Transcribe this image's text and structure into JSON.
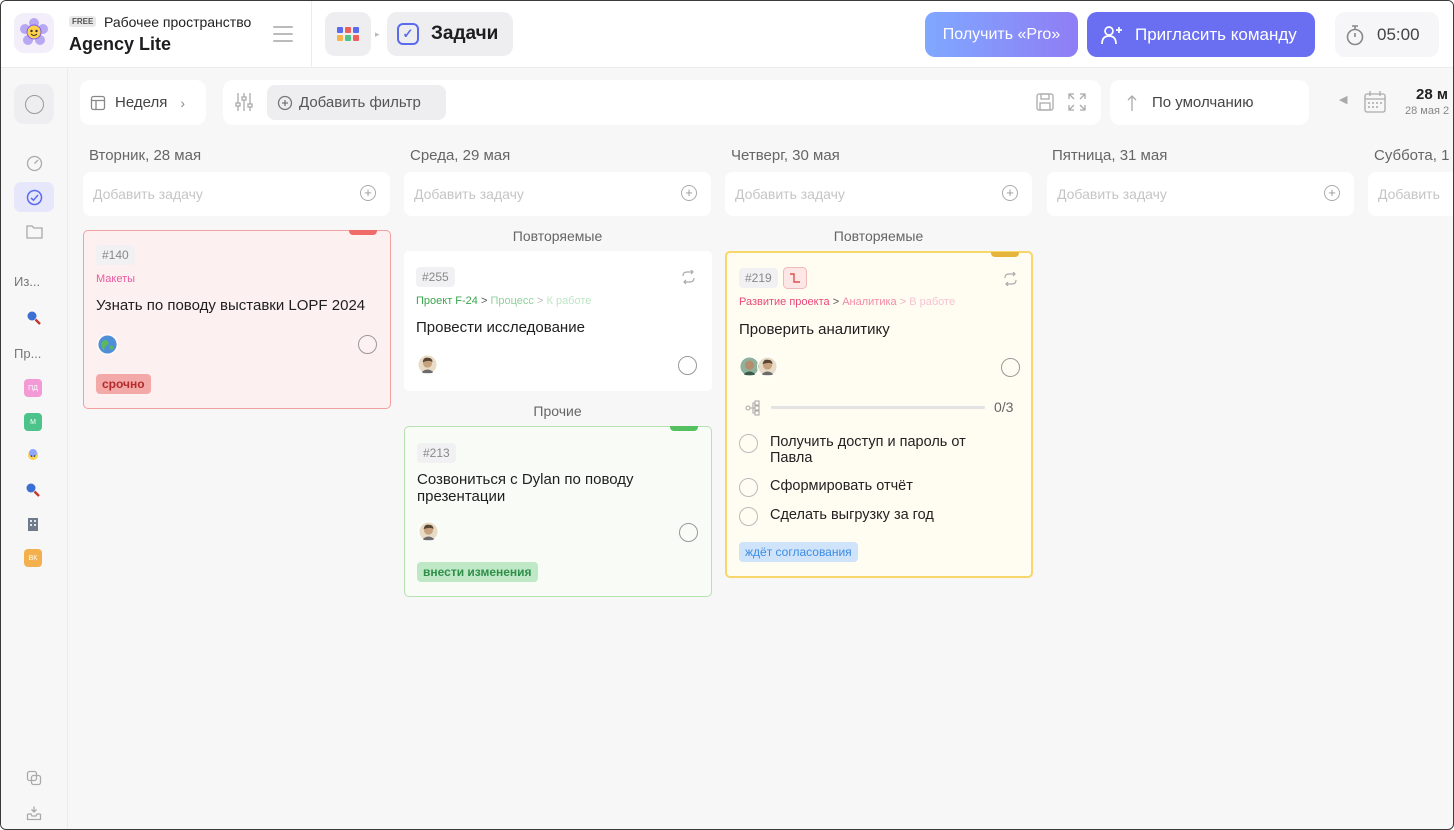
{
  "workspace": {
    "plan_badge": "FREE",
    "label": "Рабочее пространство",
    "name": "Agency Lite"
  },
  "header": {
    "section_title": "Задачи",
    "pro_button": "Получить «Pro»",
    "invite_button": "Пригласить команду",
    "timer": "05:00"
  },
  "sidebar": {
    "section_favorites": "Из...",
    "section_projects": "Пр...",
    "projects": [
      {
        "label": "ПД",
        "color": "#f39ad6"
      },
      {
        "label": "М",
        "color": "#4cc38a"
      },
      {
        "label": "",
        "color": "#ffffff"
      },
      {
        "label": "",
        "color": "#ffffff"
      },
      {
        "label": "",
        "color": "#ffffff"
      },
      {
        "label": "ВК",
        "color": "#f4b04d"
      }
    ]
  },
  "toolbar": {
    "view_label": "Неделя",
    "add_filter": "Добавить фильтр",
    "sort_label": "По умолчанию",
    "date_main": "28 м",
    "date_sub": "28 мая 2"
  },
  "columns": [
    {
      "title": "Вторник, 28 мая",
      "add_placeholder": "Добавить задачу"
    },
    {
      "title": "Среда, 29 мая",
      "add_placeholder": "Добавить задачу"
    },
    {
      "title": "Четверг, 30 мая",
      "add_placeholder": "Добавить задачу"
    },
    {
      "title": "Пятница, 31 мая",
      "add_placeholder": "Добавить задачу"
    },
    {
      "title": "Суббота, 1",
      "add_placeholder": "Добавить"
    }
  ],
  "groups": {
    "recurring": "Повторяемые",
    "other": "Прочие"
  },
  "cards": {
    "c140": {
      "id": "#140",
      "category": "Макеты",
      "title": "Узнать по поводу выставки LOPF 2024",
      "tag": "срочно"
    },
    "c255": {
      "id": "#255",
      "path_project": "Проект F-24",
      "path_sep": ">",
      "path_stage": "Процесс",
      "path_status": "К работе",
      "title": "Провести исследование"
    },
    "c213": {
      "id": "#213",
      "title_line1": "Созвониться с Dylan по поводу",
      "title_line2": "презентации",
      "tag": "внести изменения"
    },
    "c219": {
      "id": "#219",
      "path_project": "Развитие проекта",
      "path_sep": ">",
      "path_stage": "Аналитика",
      "path_status": "В работе",
      "title": "Проверить аналитику",
      "progress_text": "0/3",
      "progress": 0,
      "subtasks": [
        {
          "line1": "Получить доступ и пароль от",
          "line2": "Павла"
        },
        {
          "line1": "Сформировать отчёт",
          "line2": ""
        },
        {
          "line1": "Сделать выгрузку за год",
          "line2": ""
        }
      ],
      "tag": "ждёт согласования"
    }
  }
}
